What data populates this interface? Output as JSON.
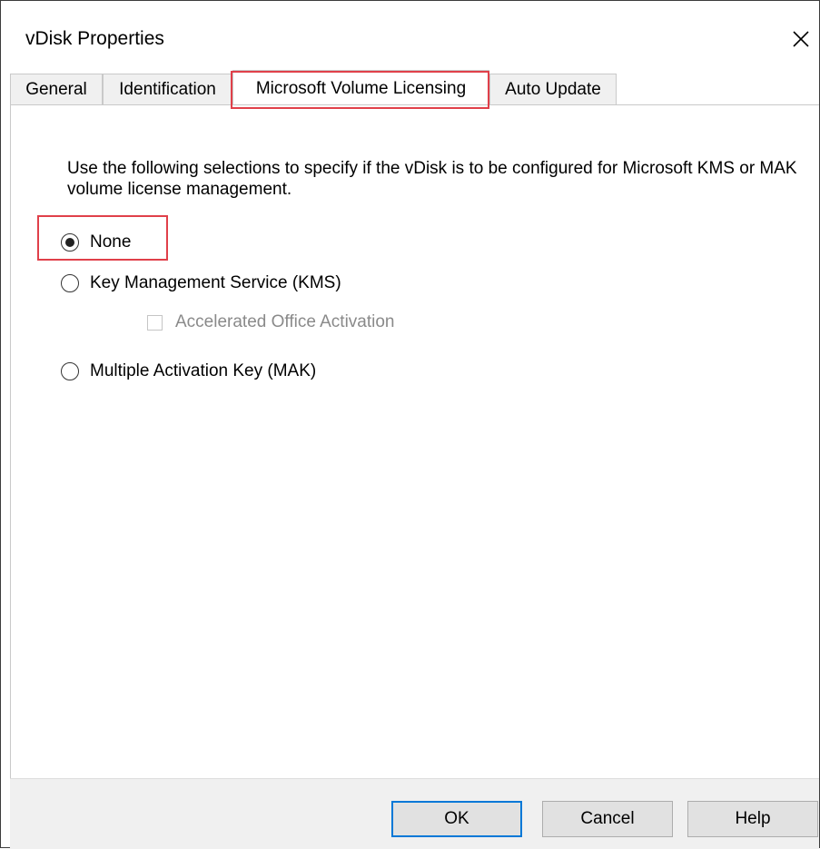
{
  "window": {
    "title": "vDisk Properties"
  },
  "tabs": [
    {
      "label": "General"
    },
    {
      "label": "Identification"
    },
    {
      "label": "Microsoft Volume Licensing"
    },
    {
      "label": "Auto Update"
    }
  ],
  "active_tab": "Microsoft Volume Licensing",
  "panel": {
    "description": "Use the following selections to specify if the vDisk is to be configured for Microsoft KMS or MAK volume license management.",
    "options": [
      {
        "label": "None",
        "checked": true
      },
      {
        "label": "Key Management Service (KMS)",
        "checked": false
      },
      {
        "label": "Multiple Activation Key (MAK)",
        "checked": false
      }
    ],
    "accelerated_office_activation": {
      "label": "Accelerated Office Activation",
      "checked": false,
      "enabled": false
    }
  },
  "buttons": {
    "ok": "OK",
    "cancel": "Cancel",
    "help": "Help"
  },
  "icons": {
    "close": "close-icon"
  },
  "colors": {
    "highlight": "#e0404a",
    "default_button_border": "#0078d7"
  }
}
